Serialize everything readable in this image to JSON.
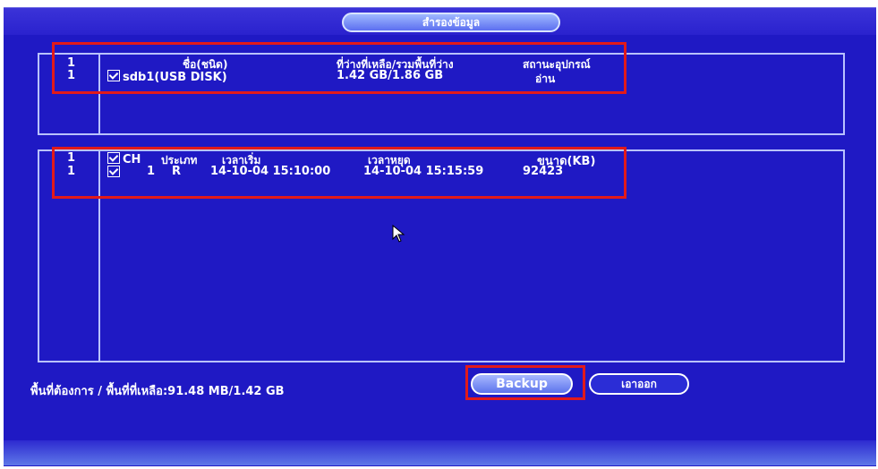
{
  "window": {
    "title": "สำรองข้อมูล"
  },
  "devices": {
    "headers": {
      "index": "1",
      "name": "ชื่อ(ชนิด)",
      "space": "ที่ว่างที่เหลือ/รวมพื้นที่ว่าง",
      "status": "สถานะอุปกรณ์"
    },
    "rows": [
      {
        "index": "1",
        "name": "sdb1(USB DISK)",
        "space": "1.42 GB/1.86 GB",
        "status": "อ่าน"
      }
    ]
  },
  "files": {
    "headers": {
      "index": "1",
      "ch": "CH",
      "type": "ประเภท",
      "start": "เวลาเริ่ม",
      "end": "เวลาหยุด",
      "size": "ขนาด(KB)"
    },
    "rows": [
      {
        "index": "1",
        "ch": "1",
        "type": "R",
        "start": "14-10-04 15:10:00",
        "end": "14-10-04 15:15:59",
        "size": "92423"
      }
    ]
  },
  "status": {
    "text": "พื้นที่ต้องการ / พื้นที่ที่เหลือ:91.48 MB/1.42 GB"
  },
  "buttons": {
    "backup": "Backup",
    "exit": "เอาออก"
  },
  "colors": {
    "background": "#1f19c4",
    "highlight": "#e21a1a"
  },
  "icons": {
    "cursor": "mouse-pointer-icon",
    "checkbox": "checkmark-icon"
  }
}
